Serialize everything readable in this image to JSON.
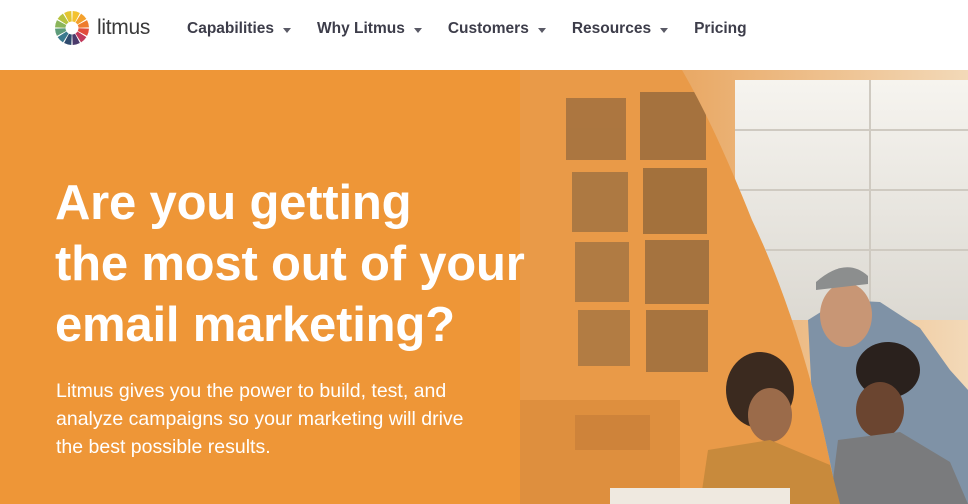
{
  "brand": {
    "name": "litmus",
    "logo_icon": "litmus-color-wheel-icon",
    "wheel_colors": [
      "#f3c22f",
      "#f4a12d",
      "#ee7c2f",
      "#e24c3b",
      "#c23a5c",
      "#4b3a6b",
      "#2f4b6e",
      "#3b7a8e",
      "#5e9c7a",
      "#8ab55a",
      "#b6c33f",
      "#e2c531"
    ]
  },
  "nav": {
    "items": [
      {
        "label": "Capabilities",
        "has_dropdown": true
      },
      {
        "label": "Why Litmus",
        "has_dropdown": true
      },
      {
        "label": "Customers",
        "has_dropdown": true
      },
      {
        "label": "Resources",
        "has_dropdown": true
      },
      {
        "label": "Pricing",
        "has_dropdown": false
      }
    ]
  },
  "hero": {
    "headline_lines": [
      "Are you getting",
      "the most out of your",
      "email marketing?"
    ],
    "subcopy_lines": [
      "Litmus gives you the power to build, test, and",
      "analyze campaigns so your marketing will drive",
      "the best possible results."
    ],
    "accent_color": "#ee9637"
  }
}
